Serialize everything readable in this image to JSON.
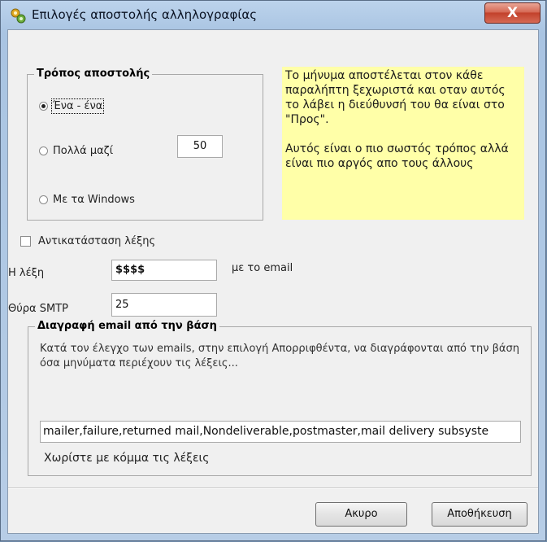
{
  "window": {
    "title": "Επιλογές αποστολής αλληλογραφίας",
    "close_label": "X",
    "app_icon": "gears-icon"
  },
  "send_mode": {
    "group_title": "Τρόπος αποστολής",
    "options": [
      {
        "label": "Ένα - ένα",
        "checked": true
      },
      {
        "label": "Πολλά μαζί",
        "checked": false
      },
      {
        "label": "Με τα Windows",
        "checked": false
      }
    ],
    "batch_size": "50"
  },
  "info": {
    "paragraph1": "Το μήνυμα αποστέλεται στον κάθε παραλήπτη ξεχωριστά και οταν αυτός το λάβει η διεύθυνσή του θα είναι στο \"Προς\".",
    "paragraph2": "Αυτός είναι ο πιο σωστός τρόπος αλλά είναι πιο αργός απο τους άλλους",
    "background": "#ffffa8"
  },
  "replace_word": {
    "checkbox_label": "Αντικατάσταση λέξης",
    "checked": false,
    "word_label": "Η λέξη",
    "word_value": "$$$$",
    "word_suffix": "με το email"
  },
  "smtp": {
    "label": "Θύρα SMTP",
    "value": "25"
  },
  "delete_group": {
    "title": "Διαγραφή email από την βάση",
    "description": "Κατά τον έλεγχο των emails, στην επιλογή Απορριφθέντα, να διαγράφονται από την βάση όσα μηνύματα περιέχουν τις λέξεις...",
    "keywords": "mailer,failure,returned mail,Nondeliverable,postmaster,mail delivery subsyste",
    "hint": "Χωρίστε με κόμμα τις λέξεις"
  },
  "buttons": {
    "cancel": "Ακυρο",
    "save": "Αποθήκευση"
  }
}
